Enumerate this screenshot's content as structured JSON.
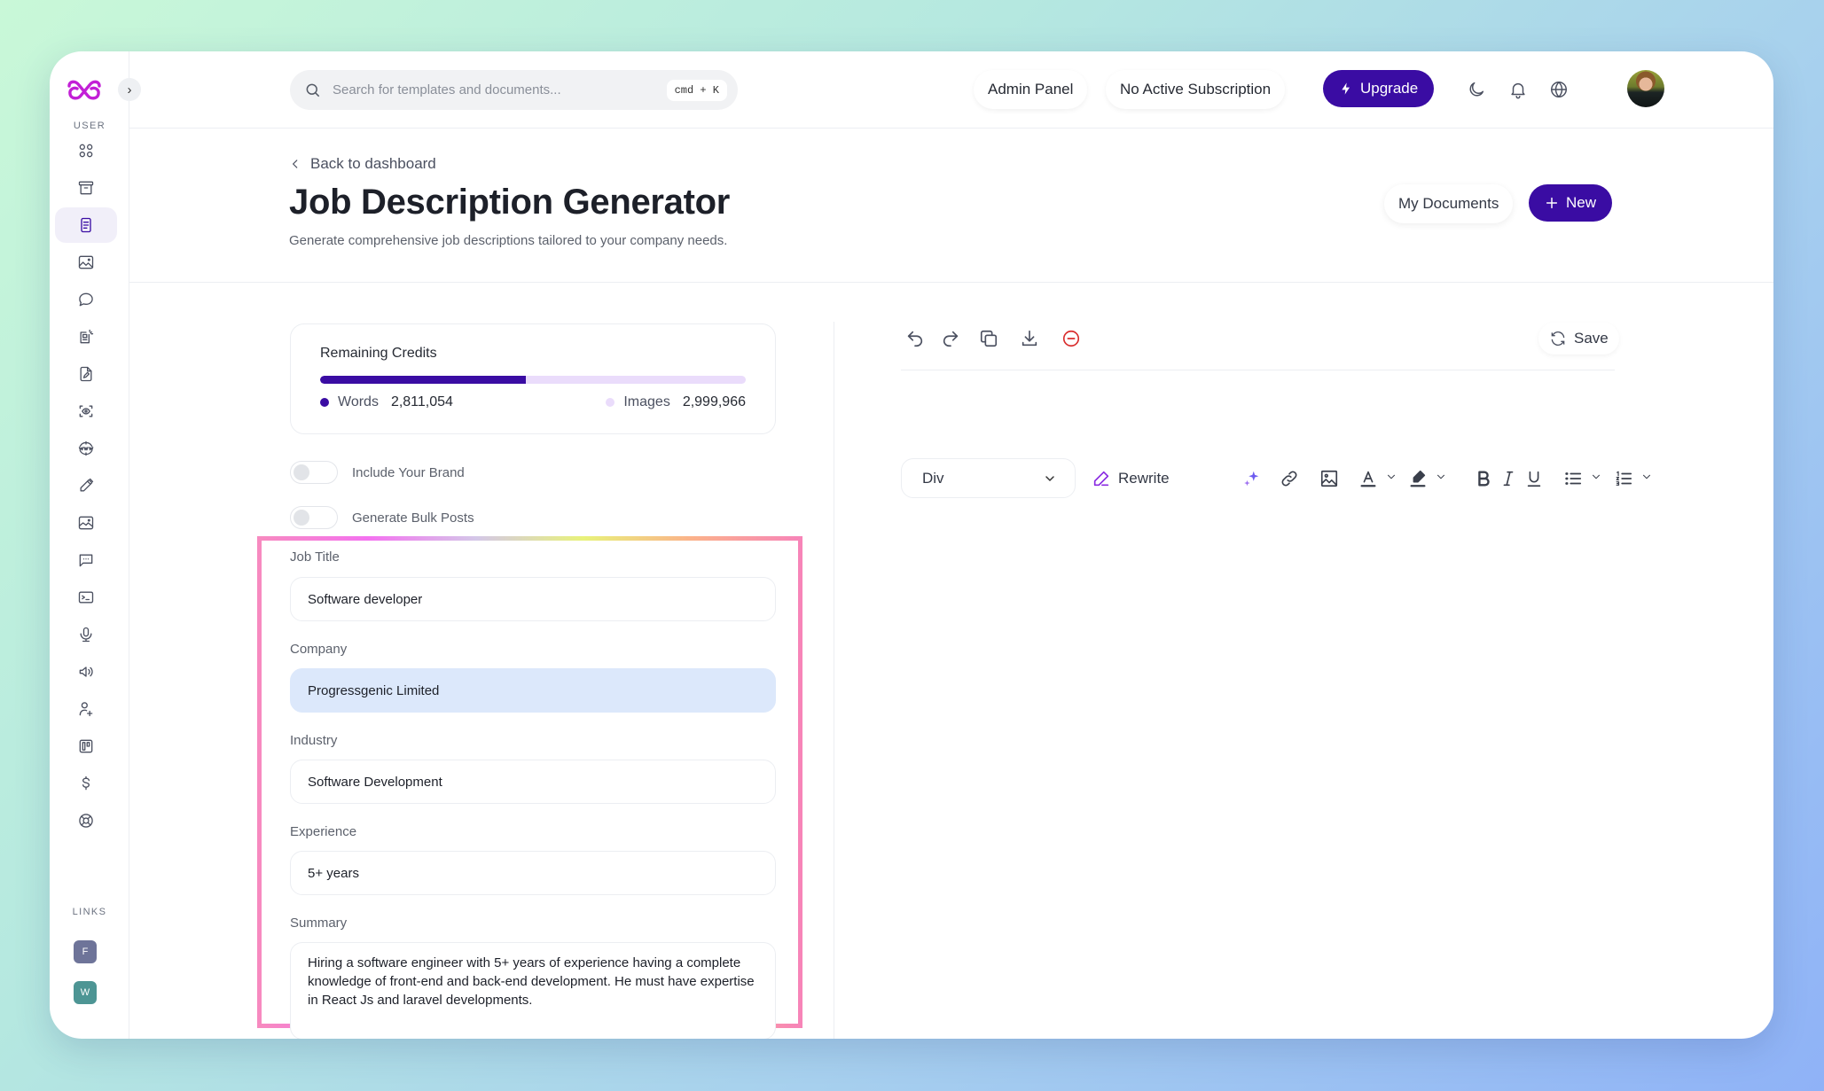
{
  "app": {
    "logo": "infinity-logo",
    "brand_color": "#3a0ca3",
    "logo_color": "#c21fd6"
  },
  "sidebar": {
    "expand_label": "›",
    "section_user": "USER",
    "items": [
      {
        "icon": "grid-icon",
        "active": false
      },
      {
        "icon": "archive-icon",
        "active": false
      },
      {
        "icon": "document-icon",
        "active": true
      },
      {
        "icon": "image-icon",
        "active": false
      },
      {
        "icon": "chat-bubble-icon",
        "active": false
      },
      {
        "icon": "document-sparkle-icon",
        "active": false
      },
      {
        "icon": "file-edit-icon",
        "active": false
      },
      {
        "icon": "scan-eye-icon",
        "active": false
      },
      {
        "icon": "www-globe-icon",
        "active": false
      },
      {
        "icon": "pencil-icon",
        "active": false
      },
      {
        "icon": "image-alt-icon",
        "active": false
      },
      {
        "icon": "message-dots-icon",
        "active": false
      },
      {
        "icon": "terminal-icon",
        "active": false
      },
      {
        "icon": "microphone-icon",
        "active": false
      },
      {
        "icon": "speaker-icon",
        "active": false
      },
      {
        "icon": "user-plus-icon",
        "active": false
      },
      {
        "icon": "kanban-icon",
        "active": false
      },
      {
        "icon": "dollar-icon",
        "active": false
      },
      {
        "icon": "lifebuoy-icon",
        "active": false
      }
    ],
    "section_links": "LINKS",
    "links": [
      {
        "label": "F",
        "color": "#6e7499"
      },
      {
        "label": "W",
        "color": "#4d9594"
      }
    ]
  },
  "topbar": {
    "search_placeholder": "Search for templates and documents...",
    "search_shortcut": "cmd + K",
    "admin_panel": "Admin Panel",
    "subscription": "No Active Subscription",
    "upgrade": "Upgrade"
  },
  "header": {
    "back_label": "Back to dashboard",
    "title": "Job Description Generator",
    "subtitle": "Generate comprehensive job descriptions tailored to your company needs.",
    "my_documents": "My Documents",
    "new_label": "New"
  },
  "credits": {
    "title": "Remaining Credits",
    "words_label": "Words",
    "words_value": "2,811,054",
    "images_label": "Images",
    "images_value": "2,999,966",
    "words_fraction": 0.484
  },
  "toggles": [
    {
      "label": "Include Your Brand",
      "on": false
    },
    {
      "label": "Generate Bulk Posts",
      "on": false
    }
  ],
  "form": {
    "job_title_label": "Job Title",
    "job_title_value": "Software developer",
    "company_label": "Company",
    "company_value": "Progressgenic Limited",
    "industry_label": "Industry",
    "industry_value": "Software Development",
    "experience_label": "Experience",
    "experience_value": "5+ years",
    "summary_label": "Summary",
    "summary_value": "Hiring a software engineer with 5+ years of experience having a complete knowledge of front-end and back-end development. He must have expertise in React Js and laravel developments."
  },
  "editor": {
    "save_label": "Save",
    "block_type": "Div",
    "rewrite_label": "Rewrite"
  }
}
